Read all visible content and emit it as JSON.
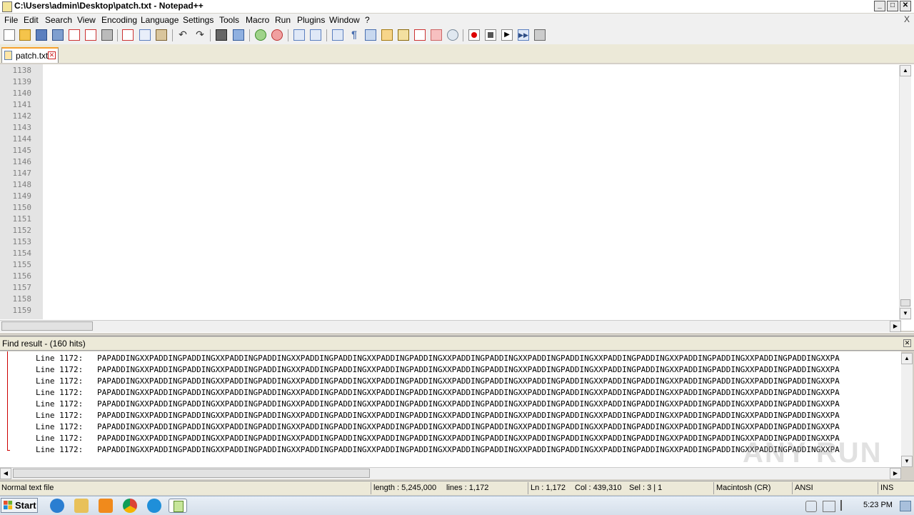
{
  "window": {
    "title": "C:\\Users\\admin\\Desktop\\patch.txt - Notepad++",
    "minimize": "_",
    "maximize": "□",
    "close": "✕"
  },
  "menu": [
    "File",
    "Edit",
    "Search",
    "View",
    "Encoding",
    "Language",
    "Settings",
    "Tools",
    "Macro",
    "Run",
    "Plugins",
    "Window",
    "?"
  ],
  "menu_close": "X",
  "tab": {
    "label": "patch.txt",
    "close": "✕"
  },
  "editor": {
    "line_numbers": [
      "1138",
      "1139",
      "1140",
      "1141",
      "1142",
      "1143",
      "1144",
      "1145",
      "1146",
      "1147",
      "1148",
      "1149",
      "1150",
      "1151",
      "1152",
      "1153",
      "1154",
      "1155",
      "1156",
      "1157",
      "1158",
      "1159"
    ]
  },
  "find": {
    "title": "Find result - (160 hits)",
    "close": "✕",
    "rows": [
      {
        "ref": "Line 1172:",
        "text": "PAPADDINGXXPADDINGPADDINGXXPADDINGPADDINGXXPADDINGPADDINGXXPADDINGPADDINGXXPADDINGPADDINGXXPADDINGPADDINGXXPADDINGPADDINGXXPADDINGPADDINGXXPADDINGPADDINGXXPA"
      },
      {
        "ref": "Line 1172:",
        "text": "PAPADDINGXXPADDINGPADDINGXXPADDINGPADDINGXXPADDINGPADDINGXXPADDINGPADDINGXXPADDINGPADDINGXXPADDINGPADDINGXXPADDINGPADDINGXXPADDINGPADDINGXXPADDINGPADDINGXXPA"
      },
      {
        "ref": "Line 1172:",
        "text": "PAPADDINGXXPADDINGPADDINGXXPADDINGPADDINGXXPADDINGPADDINGXXPADDINGPADDINGXXPADDINGPADDINGXXPADDINGPADDINGXXPADDINGPADDINGXXPADDINGPADDINGXXPADDINGPADDINGXXPA"
      },
      {
        "ref": "Line 1172:",
        "text": "PAPADDINGXXPADDINGPADDINGXXPADDINGPADDINGXXPADDINGPADDINGXXPADDINGPADDINGXXPADDINGPADDINGXXPADDINGPADDINGXXPADDINGPADDINGXXPADDINGPADDINGXXPADDINGPADDINGXXPA"
      },
      {
        "ref": "Line 1172:",
        "text": "PAPADDINGXXPADDINGPADDINGXXPADDINGPADDINGXXPADDINGPADDINGXXPADDINGPADDINGXXPADDINGPADDINGXXPADDINGPADDINGXXPADDINGPADDINGXXPADDINGPADDINGXXPADDINGPADDINGXXPA"
      },
      {
        "ref": "Line 1172:",
        "text": "PAPADDINGXXPADDINGPADDINGXXPADDINGPADDINGXXPADDINGPADDINGXXPADDINGPADDINGXXPADDINGPADDINGXXPADDINGPADDINGXXPADDINGPADDINGXXPADDINGPADDINGXXPADDINGPADDINGXXPA"
      },
      {
        "ref": "Line 1172:",
        "text": "PAPADDINGXXPADDINGPADDINGXXPADDINGPADDINGXXPADDINGPADDINGXXPADDINGPADDINGXXPADDINGPADDINGXXPADDINGPADDINGXXPADDINGPADDINGXXPADDINGPADDINGXXPADDINGPADDINGXXPA"
      },
      {
        "ref": "Line 1172:",
        "text": "PAPADDINGXXPADDINGPADDINGXXPADDINGPADDINGXXPADDINGPADDINGXXPADDINGPADDINGXXPADDINGPADDINGXXPADDINGPADDINGXXPADDINGPADDINGXXPADDINGPADDINGXXPADDINGPADDINGXXPA"
      },
      {
        "ref": "Line 1172:",
        "text": "PAPADDINGXXPADDINGPADDINGXXPADDINGPADDINGXXPADDINGPADDINGXXPADDINGPADDINGXXPADDINGPADDINGXXPADDINGPADDINGXXPADDINGPADDINGXXPADDINGPADDINGXXPADDINGPADDINGXXPA"
      }
    ]
  },
  "status": {
    "file_type": "Normal text file",
    "length": "length : 5,245,000",
    "lines": "lines : 1,172",
    "ln": "Ln : 1,172",
    "col": "Col : 439,310",
    "sel": "Sel : 3 | 1",
    "eol": "Macintosh (CR)",
    "encoding": "ANSI",
    "mode": "INS"
  },
  "taskbar": {
    "start_label": "Start",
    "clock": "5:23 PM",
    "apps": [
      "internet-explorer-icon",
      "file-explorer-icon",
      "media-player-icon",
      "chrome-icon",
      "edge-icon",
      "notepadpp-icon"
    ]
  },
  "watermark": "ANY RUN"
}
